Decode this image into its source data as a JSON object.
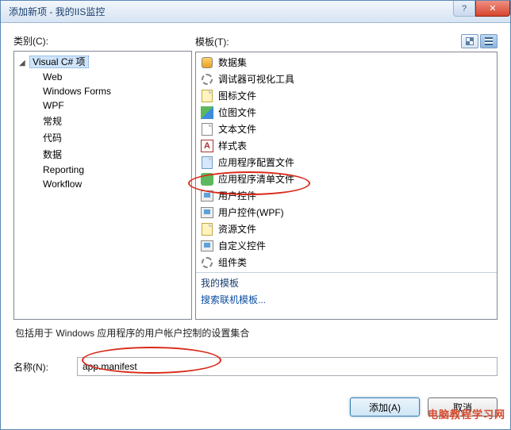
{
  "window": {
    "title": "添加新项 - 我的IIS监控"
  },
  "labels": {
    "categories": "类别(C):",
    "templates": "模板(T):",
    "myTemplates": "我的模板",
    "searchOnline": "搜索联机模板...",
    "name": "名称(N):",
    "add": "添加(A)",
    "cancel": "取消"
  },
  "categories": {
    "root": "Visual C# 项",
    "items": [
      "Web",
      "Windows Forms",
      "WPF",
      "常规",
      "代码",
      "数据",
      "Reporting",
      "Workflow"
    ]
  },
  "templates": [
    {
      "icon": "db",
      "label": "数据集"
    },
    {
      "icon": "gear",
      "label": "调试器可视化工具"
    },
    {
      "icon": "file-yellow",
      "label": "图标文件"
    },
    {
      "icon": "bmp",
      "label": "位图文件"
    },
    {
      "icon": "file",
      "label": "文本文件"
    },
    {
      "icon": "A",
      "label": "样式表"
    },
    {
      "icon": "file-blue",
      "label": "应用程序配置文件"
    },
    {
      "icon": "green",
      "label": "应用程序清单文件"
    },
    {
      "icon": "comp",
      "label": "用户控件"
    },
    {
      "icon": "comp",
      "label": "用户控件(WPF)"
    },
    {
      "icon": "file-yellow",
      "label": "资源文件"
    },
    {
      "icon": "comp",
      "label": "自定义控件"
    },
    {
      "icon": "gear",
      "label": "组件类"
    }
  ],
  "description": "包括用于 Windows 应用程序的用户帐户控制的设置集合",
  "form": {
    "name_value": "app.manifest"
  },
  "watermark": "电脑教程学习网"
}
